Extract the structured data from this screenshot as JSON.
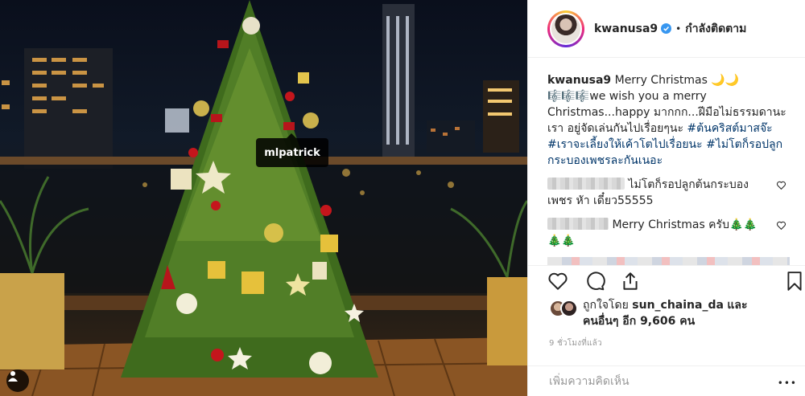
{
  "photo": {
    "tagged_user": "mlpatrick"
  },
  "header": {
    "username": "kwanusa9",
    "separator": "•",
    "follow_status": "กำลังติดตาม"
  },
  "caption": {
    "username": "kwanusa9",
    "line1": "Merry Christmas 🌙🌙",
    "line2": "🎼🎼🎼we wish you a merry Christmas...happy มากกก...ฝีมือไม่ธรรมดานะเรา อยู่จัดเล่นกันไปเรื่อยๆนะ ",
    "hashtag1": "#ต้นคริสต์มาสจ๊ะ",
    "hashtag2": "#เราจะเลี้ยงให้เค้าโตไปเรื่อยนะ",
    "hashtag3": "#ไม่โตก็รอปลูกกระบองเพชรละกันเนอะ"
  },
  "comments": [
    {
      "text": "ไม่โตก็รอปลูกต้นกระบองเพชร หัา เดี๋ยว55555"
    },
    {
      "text": "Merry Christmas ครับ🎄🎄 🎄🎄"
    }
  ],
  "likes": {
    "liked_by_prefix": "ถูกใจโดย",
    "liked_by_user": "sun_chaina_da",
    "and_text": "และ",
    "others_text": "คนอื่นๆ อีก 9,606 คน"
  },
  "timestamp": "9 ชั่วโมงที่แล้ว",
  "add_comment_placeholder": "เพิ่มความคิดเห็น",
  "more_dots": "•••",
  "icons": {
    "verified": "verified-badge-icon",
    "like": "heart-icon",
    "comment": "comment-icon",
    "share": "share-icon",
    "save": "bookmark-icon",
    "tag": "user-tag-icon"
  },
  "colors": {
    "link": "#003569",
    "verified": "#3897f0",
    "muted": "#999999"
  }
}
